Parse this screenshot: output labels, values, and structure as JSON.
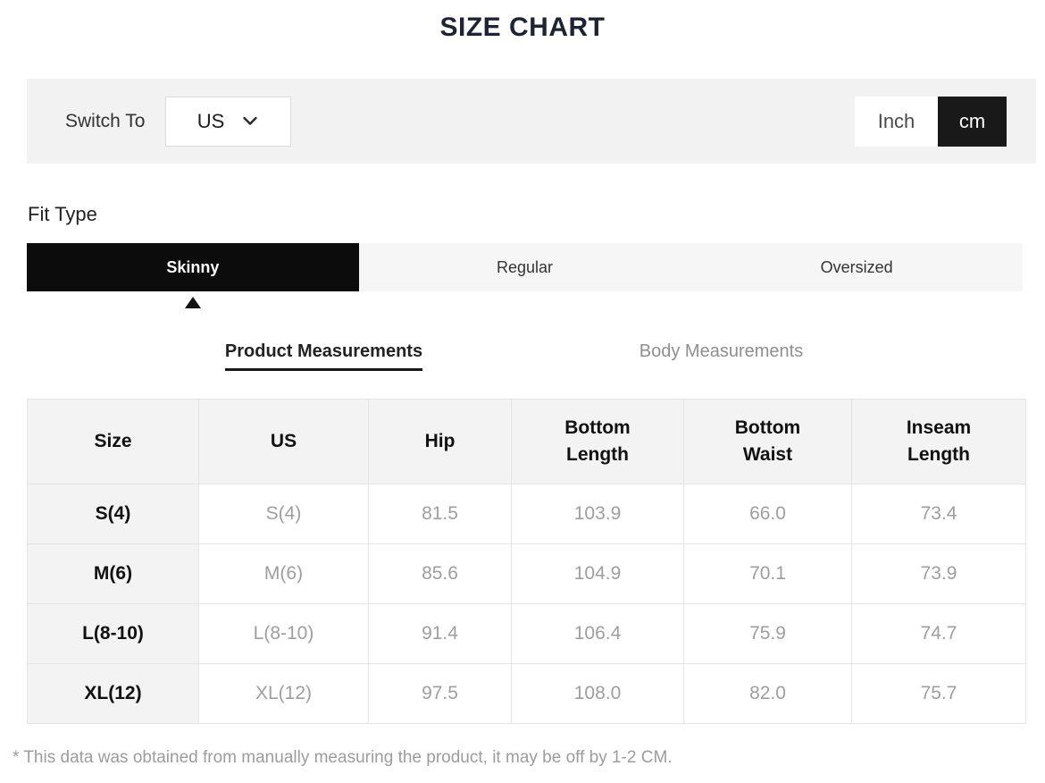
{
  "page": {
    "title": "SIZE CHART"
  },
  "switch_bar": {
    "label": "Switch To",
    "country_select": {
      "value": "US",
      "chevron_icon": "chevron-down"
    },
    "unit_toggle": {
      "options": [
        {
          "label": "Inch",
          "selected": false
        },
        {
          "label": "cm",
          "selected": true
        }
      ]
    }
  },
  "fit_type": {
    "label": "Fit Type",
    "tabs": [
      {
        "label": "Skinny",
        "selected": true
      },
      {
        "label": "Regular",
        "selected": false
      },
      {
        "label": "Oversized",
        "selected": false
      }
    ]
  },
  "measurement_tabs": [
    {
      "label": "Product Measurements",
      "selected": true
    },
    {
      "label": "Body Measurements",
      "selected": false
    }
  ],
  "size_table": {
    "columns": [
      "Size",
      "US",
      "Hip",
      "Bottom\nLength",
      "Bottom\nWaist",
      "Inseam\nLength"
    ],
    "rows": [
      [
        "S(4)",
        "S(4)",
        "81.5",
        "103.9",
        "66.0",
        "73.4"
      ],
      [
        "M(6)",
        "M(6)",
        "85.6",
        "104.9",
        "70.1",
        "73.9"
      ],
      [
        "L(8-10)",
        "L(8-10)",
        "91.4",
        "106.4",
        "75.9",
        "74.7"
      ],
      [
        "XL(12)",
        "XL(12)",
        "97.5",
        "108.0",
        "82.0",
        "75.7"
      ]
    ]
  },
  "footnote": "* This data was obtained from manually measuring the product, it may be off by 1-2 CM.",
  "colors": {
    "accent_black": "#191919",
    "selected_tab_bg": "#0c0c0c",
    "bar_bg": "#f2f2f2",
    "table_header_bg": "#f3f3f3",
    "muted_text": "#9e9e9e",
    "border": "#e4e4e4"
  }
}
